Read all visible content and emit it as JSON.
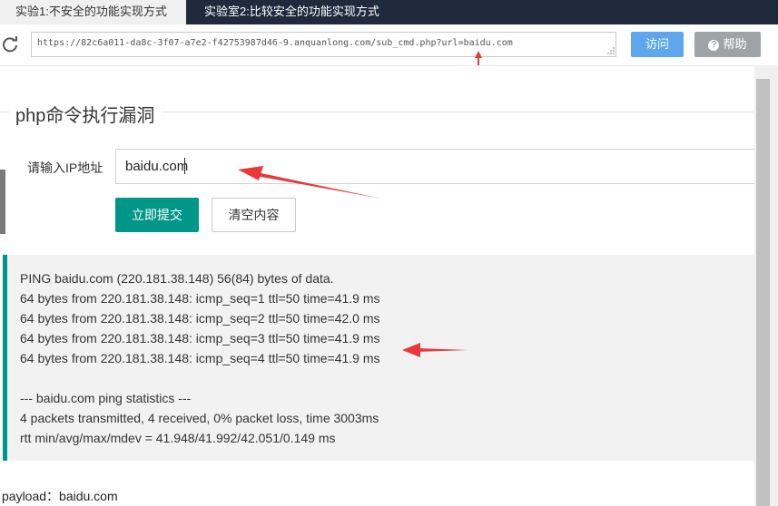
{
  "tabs": [
    {
      "label": "实验1:不安全的功能实现方式",
      "active": true
    },
    {
      "label": "实验室2:比较安全的功能实现方式",
      "active": false
    }
  ],
  "address_bar": {
    "url": "https://82c6a011-da8c-3f07-a7e2-f42753987d46-9.anquanlong.com/sub_cmd.php?url=baidu.com",
    "visit_label": "访问",
    "help_label": "帮助",
    "help_icon": "?"
  },
  "section": {
    "title": "php命令执行漏洞"
  },
  "form": {
    "ip_label": "请输入IP地址",
    "ip_value": "baidu.com",
    "submit_label": "立即提交",
    "clear_label": "清空内容"
  },
  "output": {
    "lines": [
      "PING baidu.com (220.181.38.148) 56(84) bytes of data.",
      "64 bytes from 220.181.38.148: icmp_seq=1 ttl=50 time=41.9 ms",
      "64 bytes from 220.181.38.148: icmp_seq=2 ttl=50 time=42.0 ms",
      "64 bytes from 220.181.38.148: icmp_seq=3 ttl=50 time=41.9 ms",
      "64 bytes from 220.181.38.148: icmp_seq=4 ttl=50 time=41.9 ms",
      "",
      "--- baidu.com ping statistics ---",
      "4 packets transmitted, 4 received, 0% packet loss, time 3003ms",
      "rtt min/avg/max/mdev = 41.948/41.992/42.051/0.149 ms"
    ]
  },
  "payload": "payload：baidu.com",
  "colors": {
    "tabbar": "#1f2a3d",
    "primary": "#009688",
    "visit": "#5ea7ec",
    "help": "#a0a3a6",
    "annotation_arrow": "#e8383a"
  }
}
